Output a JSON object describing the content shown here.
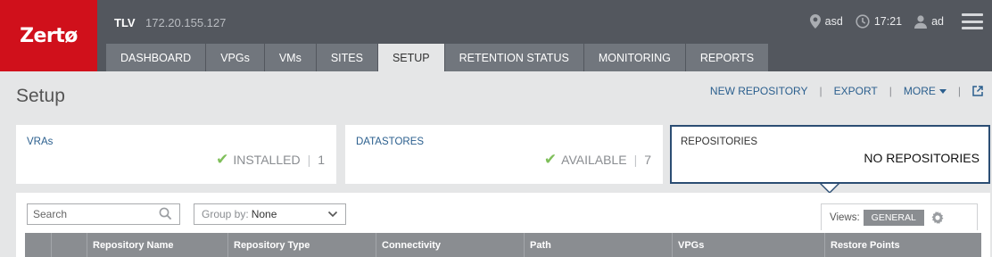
{
  "brand": {
    "logo_text": "Zertø"
  },
  "header": {
    "site_name": "TLV",
    "ip_address": "172.20.155.127",
    "location": "asd",
    "time": "17:21",
    "user": "ad"
  },
  "tabs": [
    {
      "label": "DASHBOARD"
    },
    {
      "label": "VPGs"
    },
    {
      "label": "VMs"
    },
    {
      "label": "SITES"
    },
    {
      "label": "SETUP"
    },
    {
      "label": "RETENTION STATUS"
    },
    {
      "label": "MONITORING"
    },
    {
      "label": "REPORTS"
    }
  ],
  "page": {
    "title": "Setup",
    "actions": {
      "new_repository": "NEW REPOSITORY",
      "export": "EXPORT",
      "more": "MORE"
    }
  },
  "cards": {
    "vras": {
      "label": "VRAs",
      "status": "INSTALLED",
      "count": "1"
    },
    "datastores": {
      "label": "DATASTORES",
      "status": "AVAILABLE",
      "count": "7"
    },
    "repositories": {
      "label": "REPOSITORIES",
      "status": "NO REPOSITORIES"
    }
  },
  "toolbar": {
    "search_placeholder": "Search",
    "group_by_label": "Group by:",
    "group_by_value": "None",
    "views_label": "Views:",
    "views_value": "GENERAL"
  },
  "table": {
    "columns": [
      "Repository Name",
      "Repository Type",
      "Connectivity",
      "Path",
      "VPGs",
      "Restore Points"
    ]
  },
  "colors": {
    "brand_red": "#d0101b",
    "header_bg": "#53575e",
    "link_blue": "#2b5f8e",
    "success_green": "#7fbf5a"
  },
  "icons": {
    "location": "map-pin-icon",
    "clock": "clock-icon",
    "user": "user-icon",
    "menu": "hamburger-menu-icon",
    "popout": "external-link-icon",
    "check": "checkmark-icon",
    "search": "search-icon",
    "dropdown": "chevron-down-icon",
    "settings": "gear-icon"
  }
}
